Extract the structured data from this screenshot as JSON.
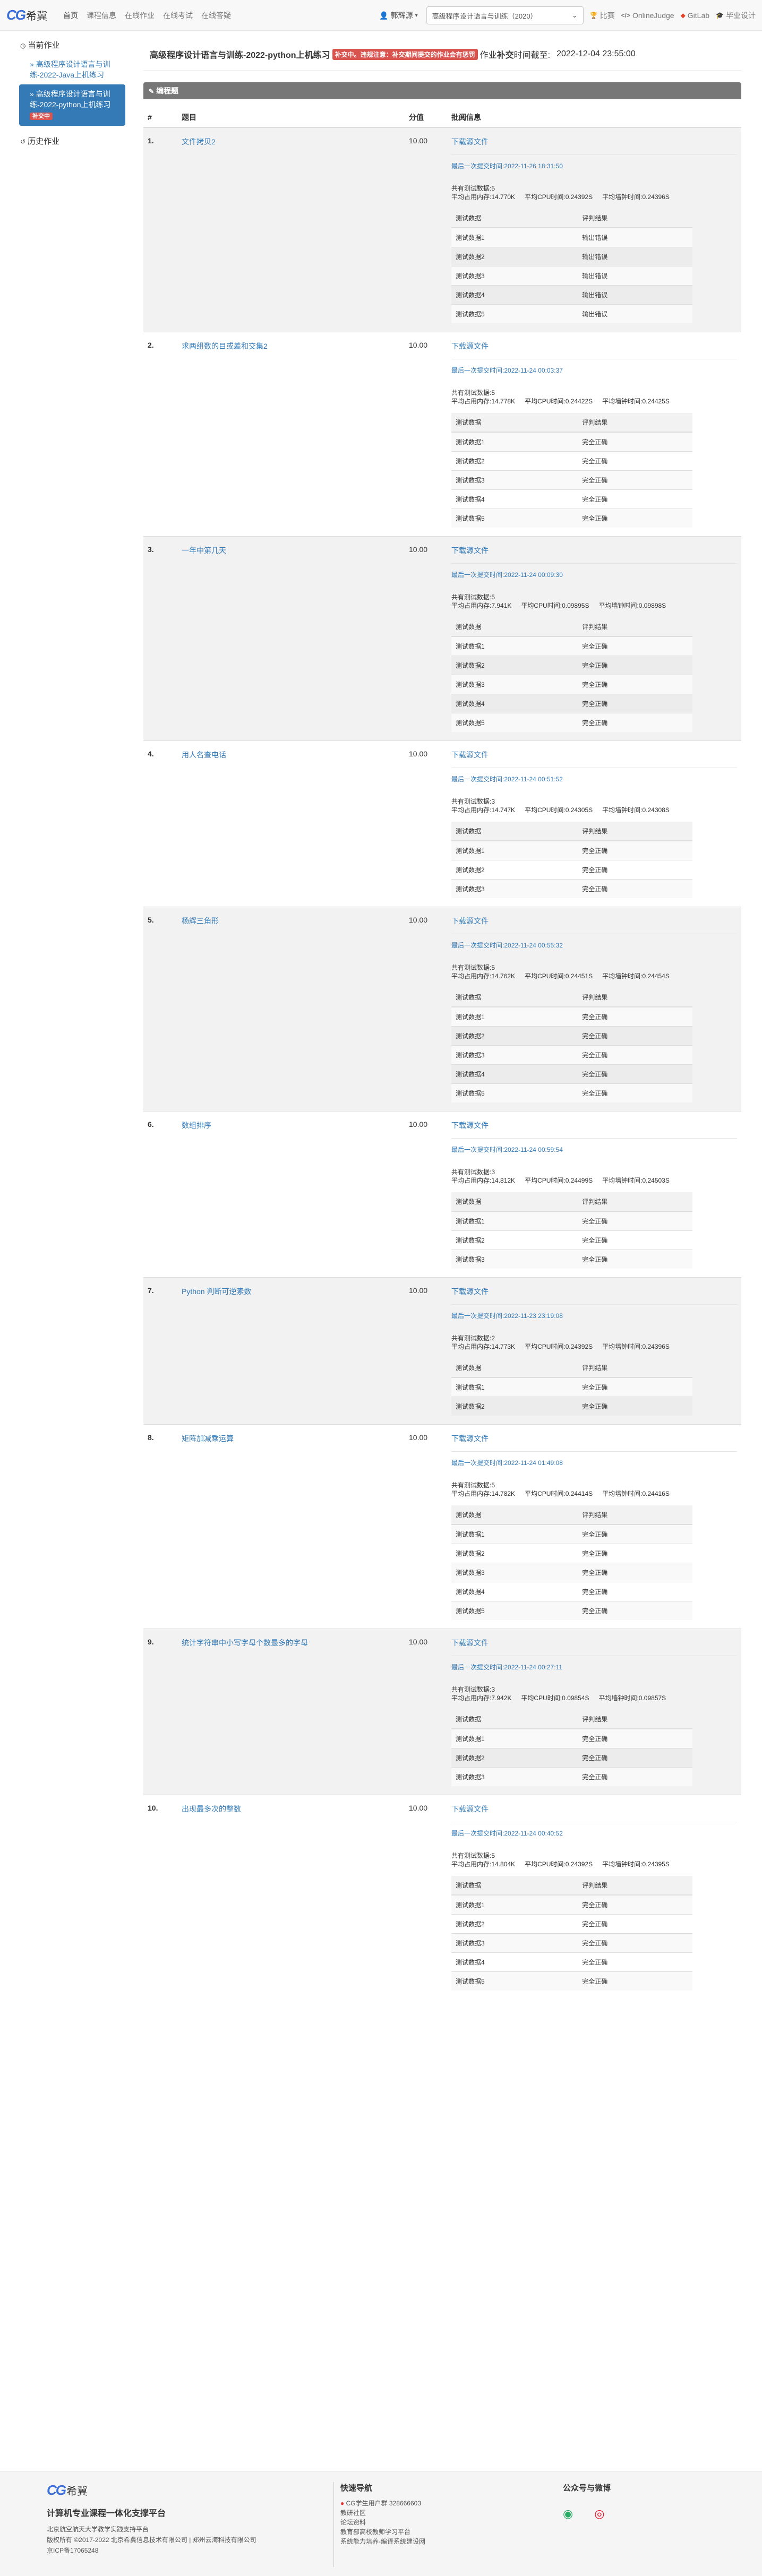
{
  "nav": {
    "logo_cg": "CG",
    "logo_text": "希冀",
    "links": [
      "首页",
      "课程信息",
      "在线作业",
      "在线考试",
      "在线答疑"
    ],
    "user": "郭辉源",
    "course": "高级程序设计语言与训练（2020）",
    "right_links": [
      "比赛",
      "OnlineJudge",
      "GitLab",
      "毕业设计"
    ]
  },
  "sidebar": {
    "current_label": "当前作业",
    "items": [
      {
        "label": "高级程序设计语言与训练-2022-Java上机练习"
      },
      {
        "label": "高级程序设计语言与训练-2022-python上机练习",
        "badge": "补交中"
      }
    ],
    "history_label": "历史作业"
  },
  "header": {
    "title": "高级程序设计语言与训练-2022-python上机练习",
    "badge": "补交中。违规注意：补交期间提交的作业会有惩罚",
    "deadline_prefix": "作业",
    "deadline_bold": "补交",
    "deadline_mid": "时间截至:",
    "deadline_value": "2022-12-04 23:55:00"
  },
  "section": {
    "title": "编程题"
  },
  "table": {
    "headers": [
      "#",
      "题目",
      "分值",
      "批阅信息"
    ],
    "download_label": "下载源文件",
    "last_prefix": "最后一次提交时间:",
    "count_prefix": "共有测试数据:",
    "mem_prefix": "平均占用内存:",
    "cpu_prefix": "平均CPU时间:",
    "wall_prefix": "平均墙钟时间:",
    "case_header": "测试数据",
    "result_header": "评判结果",
    "problems": [
      {
        "num": "1.",
        "title": "文件拷贝2",
        "score": "10.00",
        "last": "2022-11-26 18:31:50",
        "count": "5",
        "mem": "14.770K",
        "cpu": "0.24392S",
        "wall": "0.24396S",
        "cases": [
          [
            "测试数据1",
            "输出错误"
          ],
          [
            "测试数据2",
            "输出错误"
          ],
          [
            "测试数据3",
            "输出错误"
          ],
          [
            "测试数据4",
            "输出错误"
          ],
          [
            "测试数据5",
            "输出错误"
          ]
        ]
      },
      {
        "num": "2.",
        "title": "求两组数的目或差和交集2",
        "score": "10.00",
        "last": "2022-11-24 00:03:37",
        "count": "5",
        "mem": "14.778K",
        "cpu": "0.24422S",
        "wall": "0.24425S",
        "cases": [
          [
            "测试数据1",
            "完全正确"
          ],
          [
            "测试数据2",
            "完全正确"
          ],
          [
            "测试数据3",
            "完全正确"
          ],
          [
            "测试数据4",
            "完全正确"
          ],
          [
            "测试数据5",
            "完全正确"
          ]
        ]
      },
      {
        "num": "3.",
        "title": "一年中第几天",
        "score": "10.00",
        "last": "2022-11-24 00:09:30",
        "count": "5",
        "mem": "7.941K",
        "cpu": "0.09895S",
        "wall": "0.09898S",
        "cases": [
          [
            "测试数据1",
            "完全正确"
          ],
          [
            "测试数据2",
            "完全正确"
          ],
          [
            "测试数据3",
            "完全正确"
          ],
          [
            "测试数据4",
            "完全正确"
          ],
          [
            "测试数据5",
            "完全正确"
          ]
        ]
      },
      {
        "num": "4.",
        "title": "用人名查电话",
        "score": "10.00",
        "last": "2022-11-24 00:51:52",
        "count": "3",
        "mem": "14.747K",
        "cpu": "0.24305S",
        "wall": "0.24308S",
        "cases": [
          [
            "测试数据1",
            "完全正确"
          ],
          [
            "测试数据2",
            "完全正确"
          ],
          [
            "测试数据3",
            "完全正确"
          ]
        ]
      },
      {
        "num": "5.",
        "title": "杨辉三角形",
        "score": "10.00",
        "last": "2022-11-24 00:55:32",
        "count": "5",
        "mem": "14.762K",
        "cpu": "0.24451S",
        "wall": "0.24454S",
        "cases": [
          [
            "测试数据1",
            "完全正确"
          ],
          [
            "测试数据2",
            "完全正确"
          ],
          [
            "测试数据3",
            "完全正确"
          ],
          [
            "测试数据4",
            "完全正确"
          ],
          [
            "测试数据5",
            "完全正确"
          ]
        ]
      },
      {
        "num": "6.",
        "title": "数组排序",
        "score": "10.00",
        "last": "2022-11-24 00:59:54",
        "count": "3",
        "mem": "14.812K",
        "cpu": "0.24499S",
        "wall": "0.24503S",
        "cases": [
          [
            "测试数据1",
            "完全正确"
          ],
          [
            "测试数据2",
            "完全正确"
          ],
          [
            "测试数据3",
            "完全正确"
          ]
        ]
      },
      {
        "num": "7.",
        "title": "Python 判断可逆素数",
        "score": "10.00",
        "last": "2022-11-23 23:19:08",
        "count": "2",
        "mem": "14.773K",
        "cpu": "0.24392S",
        "wall": "0.24396S",
        "cases": [
          [
            "测试数据1",
            "完全正确"
          ],
          [
            "测试数据2",
            "完全正确"
          ]
        ]
      },
      {
        "num": "8.",
        "title": "矩阵加减乘运算",
        "score": "10.00",
        "last": "2022-11-24 01:49:08",
        "count": "5",
        "mem": "14.782K",
        "cpu": "0.24414S",
        "wall": "0.24416S",
        "cases": [
          [
            "测试数据1",
            "完全正确"
          ],
          [
            "测试数据2",
            "完全正确"
          ],
          [
            "测试数据3",
            "完全正确"
          ],
          [
            "测试数据4",
            "完全正确"
          ],
          [
            "测试数据5",
            "完全正确"
          ]
        ]
      },
      {
        "num": "9.",
        "title": "统计字符串中小写字母个数最多的字母",
        "score": "10.00",
        "last": "2022-11-24 00:27:11",
        "count": "3",
        "mem": "7.942K",
        "cpu": "0.09854S",
        "wall": "0.09857S",
        "cases": [
          [
            "测试数据1",
            "完全正确"
          ],
          [
            "测试数据2",
            "完全正确"
          ],
          [
            "测试数据3",
            "完全正确"
          ]
        ]
      },
      {
        "num": "10.",
        "title": "出现最多次的整数",
        "score": "10.00",
        "last": "2022-11-24 00:40:52",
        "count": "5",
        "mem": "14.804K",
        "cpu": "0.24392S",
        "wall": "0.24395S",
        "cases": [
          [
            "测试数据1",
            "完全正确"
          ],
          [
            "测试数据2",
            "完全正确"
          ],
          [
            "测试数据3",
            "完全正确"
          ],
          [
            "测试数据4",
            "完全正确"
          ],
          [
            "测试数据5",
            "完全正确"
          ]
        ]
      }
    ]
  },
  "footer": {
    "logo_cg": "CG",
    "logo_text": "希冀",
    "slogan": "计算机专业课程一体化支撑平台",
    "lines": [
      "北京航空航天大学教学实践支持平台",
      "版权所有 ©2017-2022 北京希冀信息技术有限公司 | 郑州云海科技有限公司",
      "京ICP备17065248"
    ],
    "nav_title": "快速导航",
    "nav_links": [
      "CG学生用户群 328666603",
      "教研社区",
      "论坛资料",
      "教育部高校教师学习平台",
      "系统能力培养-编译系统建设网"
    ],
    "social_title": "公众号与微博"
  }
}
